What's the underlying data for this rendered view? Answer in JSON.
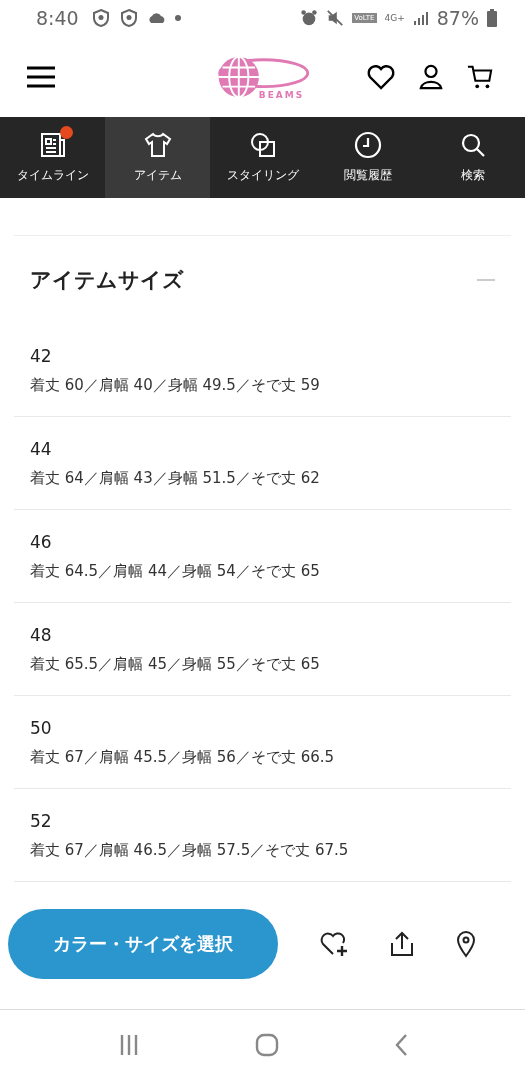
{
  "status_bar": {
    "time": "8:40",
    "network": "4G+",
    "volte": "VoLTE",
    "battery": "87%"
  },
  "header": {
    "brand": "BEAMS"
  },
  "tabs": [
    {
      "label": "タイムライン",
      "kind": "timeline",
      "selected": false,
      "badge": true
    },
    {
      "label": "アイテム",
      "kind": "item",
      "selected": true,
      "badge": false
    },
    {
      "label": "スタイリング",
      "kind": "styling",
      "selected": false,
      "badge": false
    },
    {
      "label": "閲覧履歴",
      "kind": "history",
      "selected": false,
      "badge": false
    },
    {
      "label": "検索",
      "kind": "search",
      "selected": false,
      "badge": false
    }
  ],
  "section": {
    "title": "アイテムサイズ",
    "expanded": true,
    "rows": [
      {
        "size": "42",
        "spec": "着丈 60／肩幅 40／身幅 49.5／そで丈 59"
      },
      {
        "size": "44",
        "spec": "着丈 64／肩幅 43／身幅 51.5／そで丈 62"
      },
      {
        "size": "46",
        "spec": "着丈 64.5／肩幅 44／身幅 54／そで丈 65"
      },
      {
        "size": "48",
        "spec": "着丈 65.5／肩幅 45／身幅 55／そで丈 65"
      },
      {
        "size": "50",
        "spec": "着丈 67／肩幅 45.5／身幅 56／そで丈 66.5"
      },
      {
        "size": "52",
        "spec": "着丈 67／肩幅 46.5／身幅 57.5／そで丈 67.5"
      }
    ]
  },
  "action_bar": {
    "button": "カラー・サイズを選択"
  }
}
